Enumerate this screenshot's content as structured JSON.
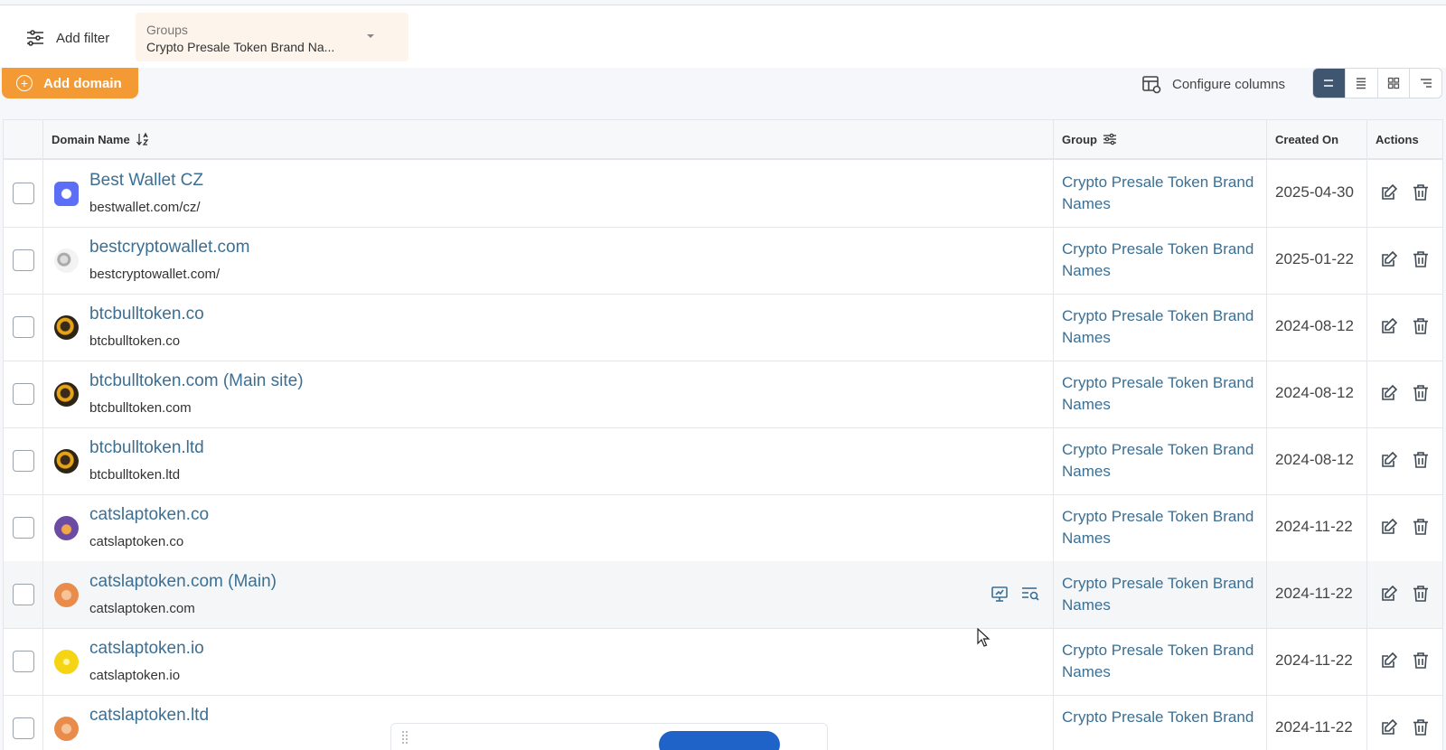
{
  "filter_bar": {
    "add_filter_label": "Add filter",
    "group_filter": {
      "label": "Groups",
      "value": "Crypto Presale Token Brand Na..."
    }
  },
  "toolbar": {
    "add_domain_label": "Add domain",
    "configure_columns_label": "Configure columns",
    "view_modes": [
      "compact",
      "list",
      "grid",
      "tree"
    ],
    "active_view": "compact"
  },
  "table": {
    "headers": {
      "domain_name": "Domain Name",
      "group": "Group",
      "created_on": "Created On",
      "actions": "Actions"
    },
    "rows": [
      {
        "title": "Best Wallet CZ",
        "url": "bestwallet.com/cz/",
        "group": "Crypto Presale Token Brand Names",
        "created": "2025-04-30",
        "favicon": "bestwallet-icon"
      },
      {
        "title": "bestcryptowallet.com",
        "url": "bestcryptowallet.com/",
        "group": "Crypto Presale Token Brand Names",
        "created": "2025-01-22",
        "favicon": "bestcryptowallet-icon"
      },
      {
        "title": "btcbulltoken.co",
        "url": "btcbulltoken.co",
        "group": "Crypto Presale Token Brand Names",
        "created": "2024-08-12",
        "favicon": "btcbull-icon"
      },
      {
        "title": "btcbulltoken.com (Main site)",
        "url": "btcbulltoken.com",
        "group": "Crypto Presale Token Brand Names",
        "created": "2024-08-12",
        "favicon": "btcbull-icon"
      },
      {
        "title": "btcbulltoken.ltd",
        "url": "btcbulltoken.ltd",
        "group": "Crypto Presale Token Brand Names",
        "created": "2024-08-12",
        "favicon": "btcbull-icon"
      },
      {
        "title": "catslaptoken.co",
        "url": "catslaptoken.co",
        "group": "Crypto Presale Token Brand Names",
        "created": "2024-11-22",
        "favicon": "catslap-icon"
      },
      {
        "title": "catslaptoken.com (Main)",
        "url": "catslaptoken.com",
        "group": "Crypto Presale Token Brand Names",
        "created": "2024-11-22",
        "favicon": "catslap-cat-icon"
      },
      {
        "title": "catslaptoken.io",
        "url": "catslaptoken.io",
        "group": "Crypto Presale Token Brand Names",
        "created": "2024-11-22",
        "favicon": "catslap-yellow-icon"
      },
      {
        "title": "catslaptoken.ltd",
        "url": "",
        "group": "Crypto Presale Token Brand",
        "created": "2024-11-22",
        "favicon": "catslap-cat-icon"
      }
    ]
  },
  "colors": {
    "accent_orange": "#f39a35",
    "link_blue": "#3b6f93",
    "active_view": "#3f5570"
  }
}
